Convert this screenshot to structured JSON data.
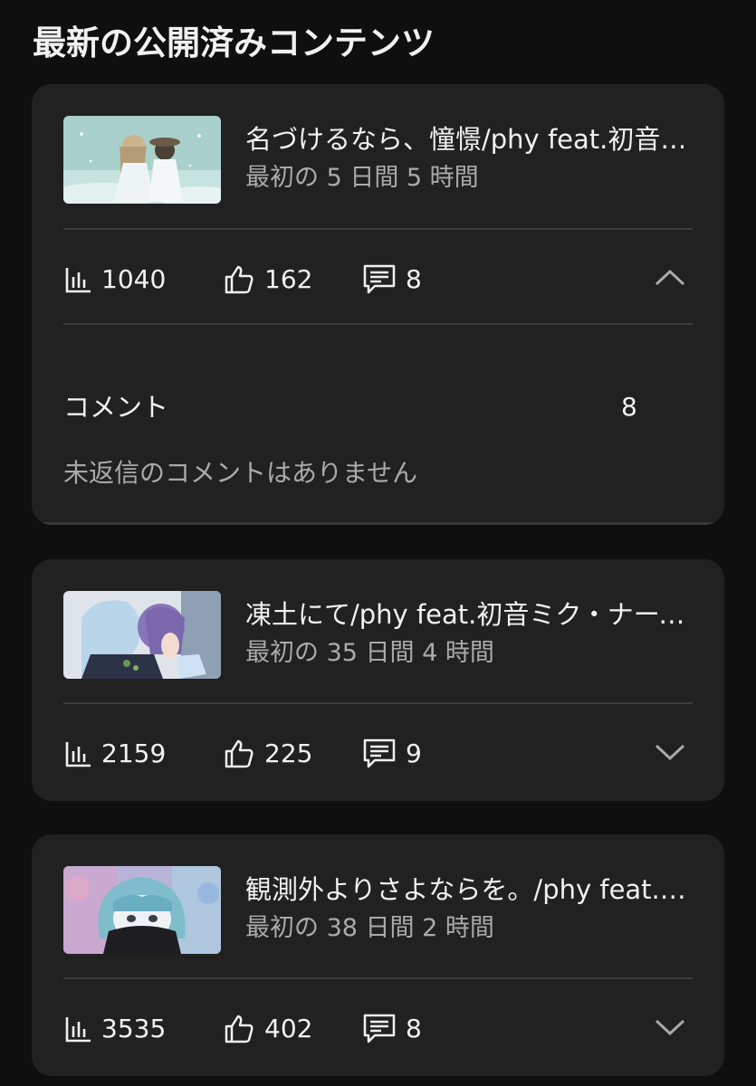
{
  "section": {
    "title": "最新の公開済みコンテンツ"
  },
  "cards": [
    {
      "title": "名づけるなら、憧憬/phy feat.初音ミク",
      "subtitle": "最初の 5 日間 5 時間",
      "views": "1040",
      "likes": "162",
      "comments": "8",
      "expanded": true,
      "detail": {
        "comment_label": "コメント",
        "comment_count": "8",
        "no_reply_text": "未返信のコメントはありません"
      }
    },
    {
      "title": "凍土にて/phy feat.初音ミク・ナースロボ＿タイプＴ",
      "subtitle": "最初の 35 日間 4 時間",
      "views": "2159",
      "likes": "225",
      "comments": "9",
      "expanded": false
    },
    {
      "title": "観測外よりさよならを。/phy feat.初音ミク",
      "subtitle": "最初の 38 日間 2 時間",
      "views": "3535",
      "likes": "402",
      "comments": "8",
      "expanded": false
    }
  ],
  "colors": {
    "background": "#0f0f0f",
    "card": "#212121",
    "primary_text": "#f1f1f1",
    "secondary_text": "#aaaaaa",
    "divider": "#3d3d3d"
  },
  "icons": {
    "views": "analytics-bars-icon",
    "likes": "thumbs-up-icon",
    "comments": "comment-bubble-icon",
    "expanded": "chevron-up-icon",
    "collapsed": "chevron-down-icon"
  }
}
